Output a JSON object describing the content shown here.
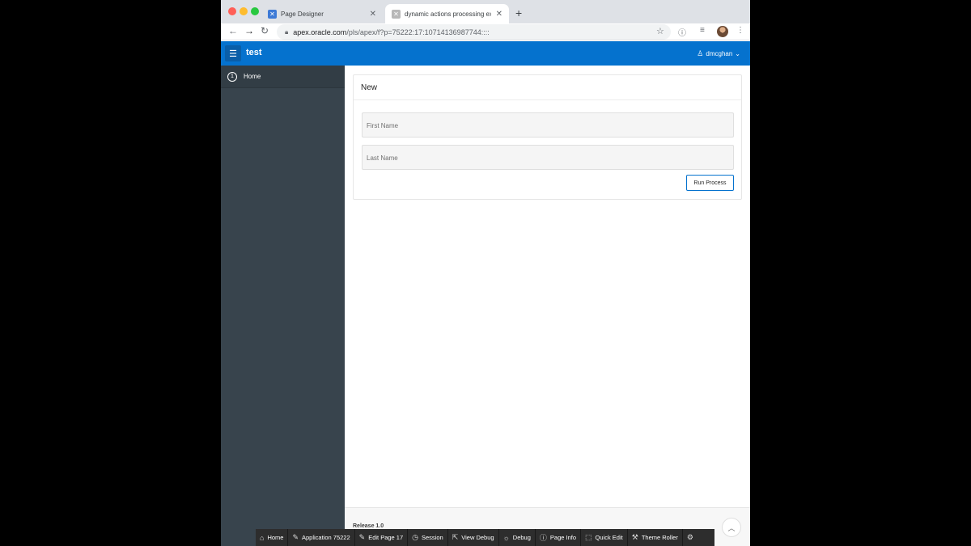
{
  "browser": {
    "tabs": [
      {
        "title": "Page Designer",
        "active": false
      },
      {
        "title": "dynamic actions processing exa",
        "active": true
      }
    ],
    "url_host": "apex.oracle.com",
    "url_path": "/pls/apex/f?p=75222:17:10714136987744::::"
  },
  "app": {
    "title": "test",
    "user": "dmcghan",
    "brand_color": "#0572ce"
  },
  "nav": {
    "items": [
      {
        "number": "1",
        "label": "Home"
      }
    ]
  },
  "region": {
    "title": "New",
    "fields": [
      {
        "label": "First Name"
      },
      {
        "label": "Last Name"
      }
    ],
    "button_label": "Run Process"
  },
  "footer": {
    "release": "Release 1.0"
  },
  "dev_toolbar": {
    "items": [
      {
        "icon": "home-icon",
        "label": "Home"
      },
      {
        "icon": "edit-app-icon",
        "label": "Application 75222"
      },
      {
        "icon": "edit-page-icon",
        "label": "Edit Page 17"
      },
      {
        "icon": "session-icon",
        "label": "Session"
      },
      {
        "icon": "view-debug-icon",
        "label": "View Debug"
      },
      {
        "icon": "debug-icon",
        "label": "Debug"
      },
      {
        "icon": "info-icon",
        "label": "Page Info"
      },
      {
        "icon": "quick-edit-icon",
        "label": "Quick Edit"
      },
      {
        "icon": "theme-roller-icon",
        "label": "Theme Roller"
      },
      {
        "icon": "gear-icon",
        "label": ""
      }
    ]
  }
}
